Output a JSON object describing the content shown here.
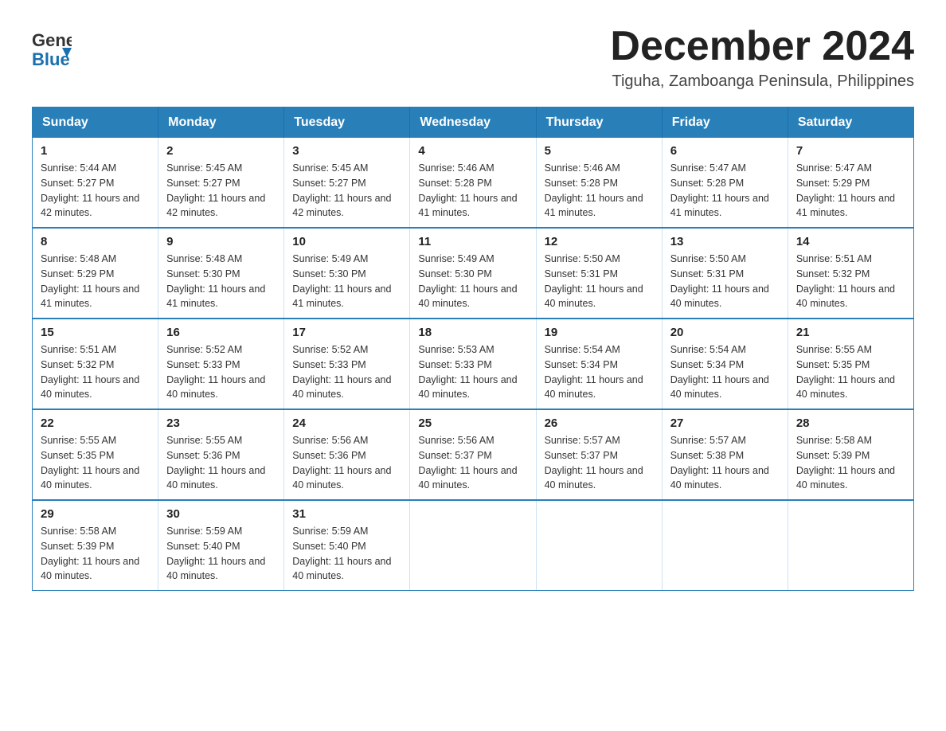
{
  "header": {
    "logo_general": "General",
    "logo_blue": "Blue",
    "month_title": "December 2024",
    "location": "Tiguha, Zamboanga Peninsula, Philippines"
  },
  "weekdays": [
    "Sunday",
    "Monday",
    "Tuesday",
    "Wednesday",
    "Thursday",
    "Friday",
    "Saturday"
  ],
  "weeks": [
    [
      {
        "day": "1",
        "sunrise": "5:44 AM",
        "sunset": "5:27 PM",
        "daylight": "11 hours and 42 minutes."
      },
      {
        "day": "2",
        "sunrise": "5:45 AM",
        "sunset": "5:27 PM",
        "daylight": "11 hours and 42 minutes."
      },
      {
        "day": "3",
        "sunrise": "5:45 AM",
        "sunset": "5:27 PM",
        "daylight": "11 hours and 42 minutes."
      },
      {
        "day": "4",
        "sunrise": "5:46 AM",
        "sunset": "5:28 PM",
        "daylight": "11 hours and 41 minutes."
      },
      {
        "day": "5",
        "sunrise": "5:46 AM",
        "sunset": "5:28 PM",
        "daylight": "11 hours and 41 minutes."
      },
      {
        "day": "6",
        "sunrise": "5:47 AM",
        "sunset": "5:28 PM",
        "daylight": "11 hours and 41 minutes."
      },
      {
        "day": "7",
        "sunrise": "5:47 AM",
        "sunset": "5:29 PM",
        "daylight": "11 hours and 41 minutes."
      }
    ],
    [
      {
        "day": "8",
        "sunrise": "5:48 AM",
        "sunset": "5:29 PM",
        "daylight": "11 hours and 41 minutes."
      },
      {
        "day": "9",
        "sunrise": "5:48 AM",
        "sunset": "5:30 PM",
        "daylight": "11 hours and 41 minutes."
      },
      {
        "day": "10",
        "sunrise": "5:49 AM",
        "sunset": "5:30 PM",
        "daylight": "11 hours and 41 minutes."
      },
      {
        "day": "11",
        "sunrise": "5:49 AM",
        "sunset": "5:30 PM",
        "daylight": "11 hours and 40 minutes."
      },
      {
        "day": "12",
        "sunrise": "5:50 AM",
        "sunset": "5:31 PM",
        "daylight": "11 hours and 40 minutes."
      },
      {
        "day": "13",
        "sunrise": "5:50 AM",
        "sunset": "5:31 PM",
        "daylight": "11 hours and 40 minutes."
      },
      {
        "day": "14",
        "sunrise": "5:51 AM",
        "sunset": "5:32 PM",
        "daylight": "11 hours and 40 minutes."
      }
    ],
    [
      {
        "day": "15",
        "sunrise": "5:51 AM",
        "sunset": "5:32 PM",
        "daylight": "11 hours and 40 minutes."
      },
      {
        "day": "16",
        "sunrise": "5:52 AM",
        "sunset": "5:33 PM",
        "daylight": "11 hours and 40 minutes."
      },
      {
        "day": "17",
        "sunrise": "5:52 AM",
        "sunset": "5:33 PM",
        "daylight": "11 hours and 40 minutes."
      },
      {
        "day": "18",
        "sunrise": "5:53 AM",
        "sunset": "5:33 PM",
        "daylight": "11 hours and 40 minutes."
      },
      {
        "day": "19",
        "sunrise": "5:54 AM",
        "sunset": "5:34 PM",
        "daylight": "11 hours and 40 minutes."
      },
      {
        "day": "20",
        "sunrise": "5:54 AM",
        "sunset": "5:34 PM",
        "daylight": "11 hours and 40 minutes."
      },
      {
        "day": "21",
        "sunrise": "5:55 AM",
        "sunset": "5:35 PM",
        "daylight": "11 hours and 40 minutes."
      }
    ],
    [
      {
        "day": "22",
        "sunrise": "5:55 AM",
        "sunset": "5:35 PM",
        "daylight": "11 hours and 40 minutes."
      },
      {
        "day": "23",
        "sunrise": "5:55 AM",
        "sunset": "5:36 PM",
        "daylight": "11 hours and 40 minutes."
      },
      {
        "day": "24",
        "sunrise": "5:56 AM",
        "sunset": "5:36 PM",
        "daylight": "11 hours and 40 minutes."
      },
      {
        "day": "25",
        "sunrise": "5:56 AM",
        "sunset": "5:37 PM",
        "daylight": "11 hours and 40 minutes."
      },
      {
        "day": "26",
        "sunrise": "5:57 AM",
        "sunset": "5:37 PM",
        "daylight": "11 hours and 40 minutes."
      },
      {
        "day": "27",
        "sunrise": "5:57 AM",
        "sunset": "5:38 PM",
        "daylight": "11 hours and 40 minutes."
      },
      {
        "day": "28",
        "sunrise": "5:58 AM",
        "sunset": "5:39 PM",
        "daylight": "11 hours and 40 minutes."
      }
    ],
    [
      {
        "day": "29",
        "sunrise": "5:58 AM",
        "sunset": "5:39 PM",
        "daylight": "11 hours and 40 minutes."
      },
      {
        "day": "30",
        "sunrise": "5:59 AM",
        "sunset": "5:40 PM",
        "daylight": "11 hours and 40 minutes."
      },
      {
        "day": "31",
        "sunrise": "5:59 AM",
        "sunset": "5:40 PM",
        "daylight": "11 hours and 40 minutes."
      },
      null,
      null,
      null,
      null
    ]
  ]
}
